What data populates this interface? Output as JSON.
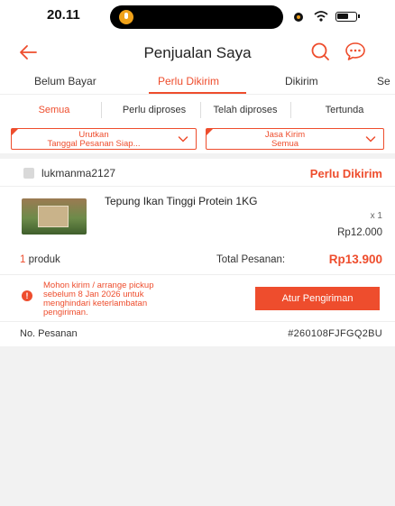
{
  "status_bar": {
    "time": "20.11"
  },
  "header": {
    "title": "Penjualan Saya"
  },
  "tabs": [
    {
      "label": "Belum Bayar"
    },
    {
      "label": "Perlu Dikirim",
      "active": true
    },
    {
      "label": "Dikirim"
    },
    {
      "label": "Se"
    }
  ],
  "subtabs": [
    {
      "label": "Semua",
      "active": true
    },
    {
      "label": "Perlu diproses"
    },
    {
      "label": "Telah diproses"
    },
    {
      "label": "Tertunda"
    }
  ],
  "filters": {
    "sort": {
      "line1": "Urutkan",
      "line2": "Tanggal Pesanan Siap..."
    },
    "courier": {
      "line1": "Jasa Kirim",
      "line2": "Semua"
    }
  },
  "order": {
    "buyer": "lukmanma2127",
    "status": "Perlu Dikirim",
    "product_name": "Tepung Ikan Tinggi Protein 1KG",
    "quantity": "x 1",
    "price": "Rp12.000",
    "product_count_num": "1",
    "product_count_word": " produk",
    "total_label": "Total Pesanan:",
    "total_value": "Rp13.900",
    "warning_lines": [
      "Mohon kirim / arrange pickup",
      "sebelum 8 Jan 2026 untuk",
      "menghindari keterlambatan",
      "pengiriman."
    ],
    "arrange_button": "Atur Pengiriman",
    "order_label": "No. Pesanan",
    "order_number": "#260108FJFGQ2BU"
  },
  "icons": {
    "back": "arrow-left-icon",
    "search": "search-icon",
    "chat": "chat-icon"
  },
  "colors": {
    "accent": "#ee4d2d",
    "background": "#f2f2f2",
    "card": "#ffffff"
  }
}
